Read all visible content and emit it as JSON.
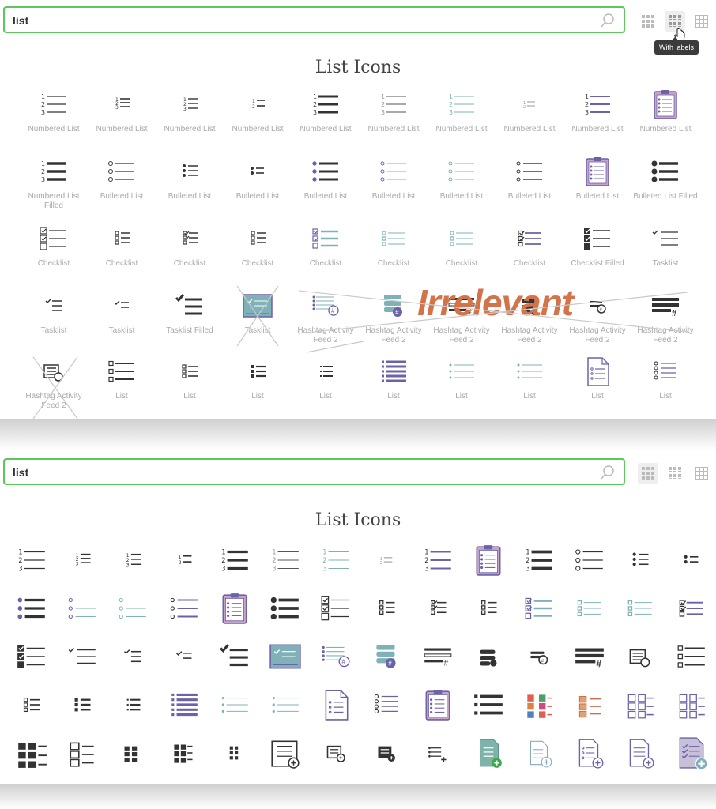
{
  "search": {
    "value": "list"
  },
  "view_modes": [
    {
      "name": "grid-icon"
    },
    {
      "name": "grid-with-labels-icon"
    },
    {
      "name": "table-grid-icon"
    }
  ],
  "tooltip": "With labels",
  "section_title": "List Icons",
  "overlay_text": "Irrelevant",
  "labeled_icons": [
    {
      "label": "Numbered List",
      "kind": "num1"
    },
    {
      "label": "Numbered List",
      "kind": "num2"
    },
    {
      "label": "Numbered List",
      "kind": "num3"
    },
    {
      "label": "Numbered List",
      "kind": "num4"
    },
    {
      "label": "Numbered List",
      "kind": "num5"
    },
    {
      "label": "Numbered List",
      "kind": "num6"
    },
    {
      "label": "Numbered List",
      "kind": "num7"
    },
    {
      "label": "Numbered List",
      "kind": "num8"
    },
    {
      "label": "Numbered List",
      "kind": "num9"
    },
    {
      "label": "Numbered List",
      "kind": "clip"
    },
    {
      "label": "Numbered List Filled",
      "kind": "numfill"
    },
    {
      "label": "Bulleted List",
      "kind": "bul1"
    },
    {
      "label": "Bulleted List",
      "kind": "bul2"
    },
    {
      "label": "Bulleted List",
      "kind": "bul3"
    },
    {
      "label": "Bulleted List",
      "kind": "bul4"
    },
    {
      "label": "Bulleted List",
      "kind": "bul5"
    },
    {
      "label": "Bulleted List",
      "kind": "bul6"
    },
    {
      "label": "Bulleted List",
      "kind": "bul7"
    },
    {
      "label": "Bulleted List",
      "kind": "clip"
    },
    {
      "label": "Bulleted List Filled",
      "kind": "bulfill"
    },
    {
      "label": "Checklist",
      "kind": "chk1"
    },
    {
      "label": "Checklist",
      "kind": "chk2"
    },
    {
      "label": "Checklist",
      "kind": "chk3"
    },
    {
      "label": "Checklist",
      "kind": "chk2"
    },
    {
      "label": "Checklist",
      "kind": "chk4"
    },
    {
      "label": "Checklist",
      "kind": "chk5"
    },
    {
      "label": "Checklist",
      "kind": "chk5"
    },
    {
      "label": "Checklist",
      "kind": "chk6"
    },
    {
      "label": "Checklist Filled",
      "kind": "chkfill"
    },
    {
      "label": "Tasklist",
      "kind": "task1"
    },
    {
      "label": "Tasklist",
      "kind": "task2"
    },
    {
      "label": "Tasklist",
      "kind": "task3"
    },
    {
      "label": "Tasklist Filled",
      "kind": "taskfill"
    },
    {
      "label": "Tasklist",
      "kind": "screen"
    },
    {
      "label": "Hashtag Activity Feed 2",
      "kind": "hash1"
    },
    {
      "label": "Hashtag Activity Feed 2",
      "kind": "hash2"
    },
    {
      "label": "Hashtag Activity Feed 2",
      "kind": "hash3"
    },
    {
      "label": "Hashtag Activity Feed 2",
      "kind": "hash4"
    },
    {
      "label": "Hashtag Activity Feed 2",
      "kind": "hash5"
    },
    {
      "label": "Hashtag Activity Feed 2",
      "kind": "hash6"
    },
    {
      "label": "Hashtag Activity Feed 2",
      "kind": "hash7"
    },
    {
      "label": "List",
      "kind": "list1"
    },
    {
      "label": "List",
      "kind": "list2"
    },
    {
      "label": "List",
      "kind": "list3"
    },
    {
      "label": "List",
      "kind": "list4"
    },
    {
      "label": "List",
      "kind": "list5"
    },
    {
      "label": "List",
      "kind": "list6"
    },
    {
      "label": "List",
      "kind": "list6"
    },
    {
      "label": "List",
      "kind": "doc"
    },
    {
      "label": "List",
      "kind": "list7"
    }
  ],
  "compact_icons": [
    "num1",
    "num2",
    "num3",
    "num4",
    "num5",
    "num6",
    "num7",
    "num8",
    "num9",
    "clip",
    "numfill",
    "bul1",
    "bul2",
    "bul3",
    "bul4",
    "bul5",
    "bul6",
    "bul7",
    "clip",
    "bulfill",
    "chk1",
    "chk2",
    "chk3",
    "chk2",
    "chk4",
    "chk5",
    "chk5",
    "chk6",
    "chkfill",
    "task1",
    "task2",
    "task3",
    "taskfill",
    "screen",
    "hash1",
    "hash2",
    "hash3",
    "hash4",
    "hash5",
    "hash6",
    "hash7",
    "list1",
    "list2",
    "list3",
    "list4",
    "list5",
    "list6",
    "list6",
    "doc",
    "list7",
    "clip",
    "list8",
    "mosaic1",
    "mosaic2",
    "mosaic3",
    "mosaic3",
    "mosaic4",
    "mosaic5",
    "mosaic6",
    "mosaic7",
    "mosaic8",
    "mosaic9",
    "addlist1",
    "addlist2",
    "addlist3",
    "addlist4",
    "addlist5",
    "adddoc1",
    "adddoc2",
    "adddoc3"
  ]
}
